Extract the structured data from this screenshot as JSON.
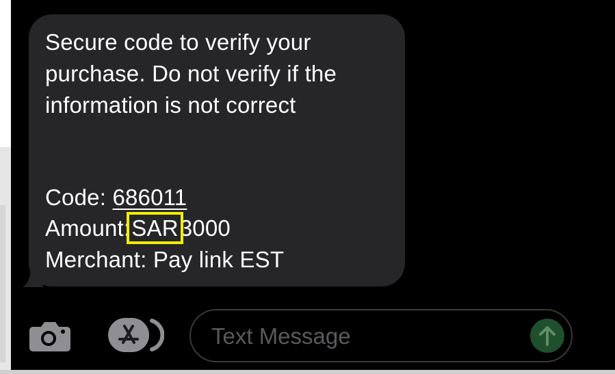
{
  "message": {
    "lines": [
      "Secure code to verify your",
      "purchase. Do not verify if the",
      "information is not correct"
    ],
    "code_label": "Code: ",
    "code_value": "686011",
    "amount_label": "Amount:",
    "amount_currency": "SAR",
    "amount_value": "3000",
    "merchant_line": "Merchant: Pay link EST"
  },
  "input_bar": {
    "placeholder": "Text Message"
  },
  "colors": {
    "bubble": "#262628",
    "highlight": "#f2ee00",
    "send_button": "#1f4f2c"
  },
  "icons": [
    "camera-icon",
    "app-store-icon",
    "send-arrow-icon"
  ]
}
